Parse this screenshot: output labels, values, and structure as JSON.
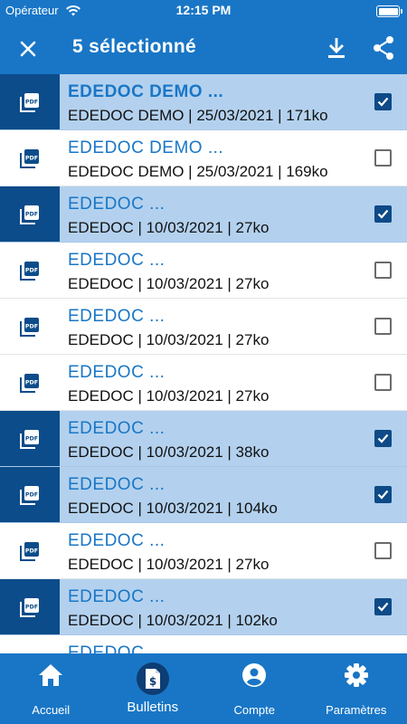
{
  "status_bar": {
    "carrier": "Opérateur",
    "time": "12:15 PM"
  },
  "header": {
    "title": "5 sélectionné"
  },
  "documents": [
    {
      "title": "EDEDOC DEMO  ...",
      "subtitle": "EDEDOC DEMO | 25/03/2021 | 171ko",
      "selected": true,
      "bold": true
    },
    {
      "title": "EDEDOC DEMO  ...",
      "subtitle": "EDEDOC DEMO | 25/03/2021 | 169ko",
      "selected": false,
      "bold": false
    },
    {
      "title": "EDEDOC  ...",
      "subtitle": "EDEDOC | 10/03/2021 | 27ko",
      "selected": true,
      "bold": false
    },
    {
      "title": "EDEDOC  ...",
      "subtitle": "EDEDOC | 10/03/2021 | 27ko",
      "selected": false,
      "bold": false
    },
    {
      "title": "EDEDOC  ...",
      "subtitle": "EDEDOC | 10/03/2021 | 27ko",
      "selected": false,
      "bold": false
    },
    {
      "title": "EDEDOC  ...",
      "subtitle": "EDEDOC | 10/03/2021 | 27ko",
      "selected": false,
      "bold": false
    },
    {
      "title": "EDEDOC  ...",
      "subtitle": "EDEDOC | 10/03/2021 | 38ko",
      "selected": true,
      "bold": false
    },
    {
      "title": "EDEDOC  ...",
      "subtitle": "EDEDOC | 10/03/2021 | 104ko",
      "selected": true,
      "bold": false
    },
    {
      "title": "EDEDOC  ...",
      "subtitle": "EDEDOC | 10/03/2021 | 27ko",
      "selected": false,
      "bold": false
    },
    {
      "title": "EDEDOC  ...",
      "subtitle": "EDEDOC | 10/03/2021 | 102ko",
      "selected": true,
      "bold": false
    },
    {
      "title": "EDEDOC  ...",
      "subtitle": "",
      "selected": false,
      "bold": false
    }
  ],
  "bottom_nav": {
    "items": [
      {
        "label": "Accueil",
        "icon": "home-icon",
        "active": false
      },
      {
        "label": "Bulletins",
        "icon": "payslip-icon",
        "active": true
      },
      {
        "label": "Compte",
        "icon": "account-icon",
        "active": false
      },
      {
        "label": "Paramètres",
        "icon": "settings-icon",
        "active": false
      }
    ]
  },
  "colors": {
    "primary": "#1976c6",
    "selected_row": "#b3d1ee",
    "dark_blue": "#0c4c8a",
    "link_text": "#1976c6"
  }
}
